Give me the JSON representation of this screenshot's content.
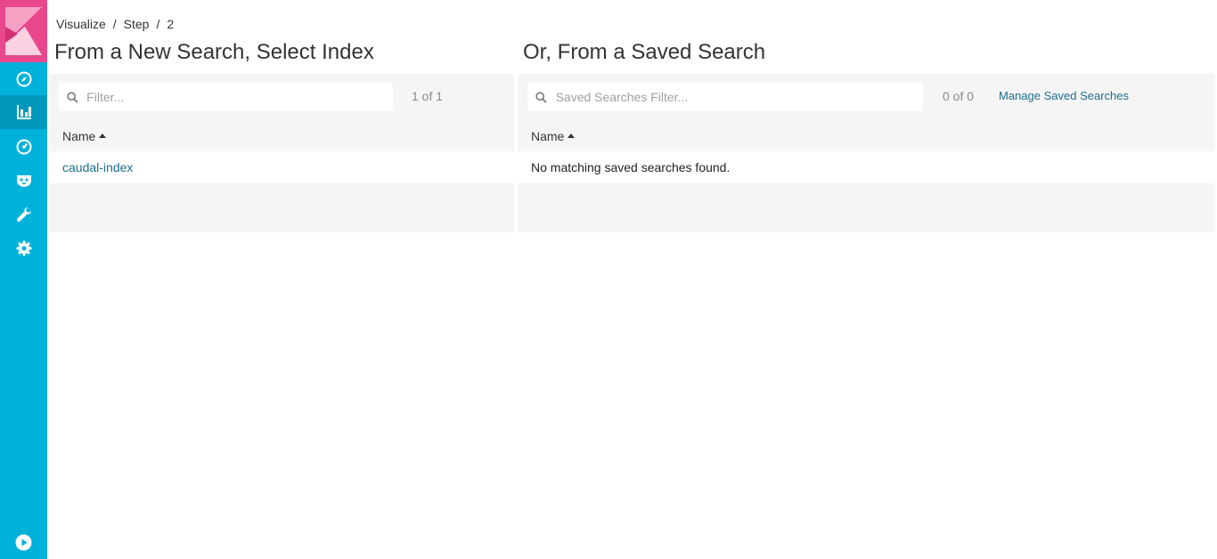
{
  "sidebar": {
    "items": [
      {
        "icon": "compass-icon",
        "active": false
      },
      {
        "icon": "bar-chart-icon",
        "active": true
      },
      {
        "icon": "dashboard-gauge-icon",
        "active": false
      },
      {
        "icon": "timelion-mask-icon",
        "active": false
      },
      {
        "icon": "wrench-icon",
        "active": false
      },
      {
        "icon": "gear-icon",
        "active": false
      }
    ],
    "bottom_icon": "play-circle-icon",
    "colors": {
      "background": "#00b2d9",
      "logo": "#e8478b",
      "active": "#0099bb"
    }
  },
  "breadcrumb": {
    "items": [
      "Visualize",
      "Step",
      "2"
    ],
    "separator": "/"
  },
  "left_panel": {
    "title": "From a New Search, Select Index",
    "filter_placeholder": "Filter...",
    "pager": "1 of 1",
    "column_header": "Name",
    "rows": [
      "caudal-index"
    ]
  },
  "right_panel": {
    "title": "Or, From a Saved Search",
    "filter_placeholder": "Saved Searches Filter...",
    "pager": "0 of 0",
    "manage_link": "Manage Saved Searches",
    "column_header": "Name",
    "empty_message": "No matching saved searches found."
  },
  "colors": {
    "link": "#1b6f8f",
    "panel_bg": "#f5f5f5"
  }
}
